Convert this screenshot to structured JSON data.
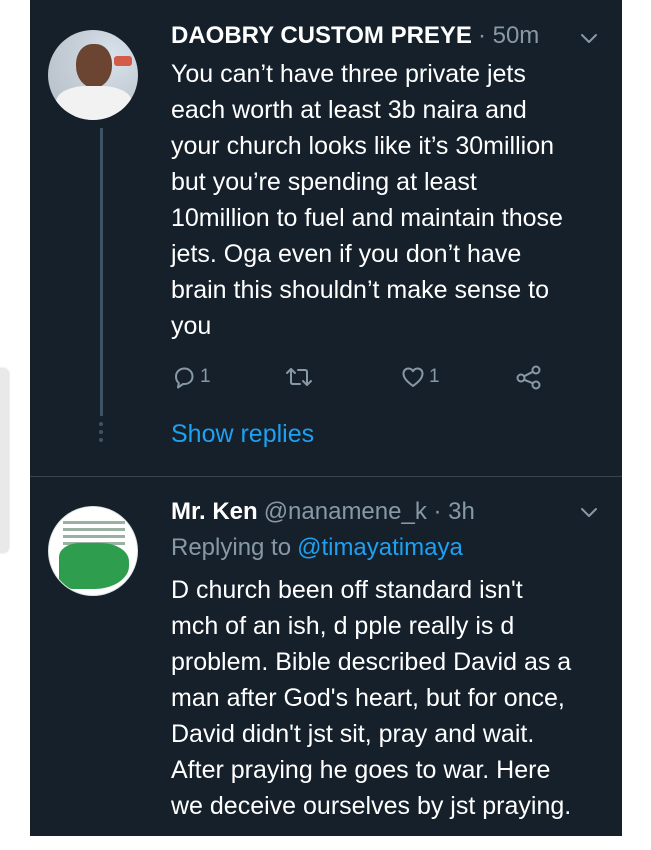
{
  "tweets": [
    {
      "author": "DAOBRY CUSTOM PREYE",
      "meta": "· 50m",
      "text": "You can’t have three private jets\neach worth at least 3b naira and\nyour church looks like it’s 30million\nbut you’re spending at least\n10million to fuel and maintain those\njets. Oga even if you don’t have\nbrain this shouldn’t make sense to\nyou",
      "reply_count": "1",
      "retweet_count": "",
      "like_count": "1",
      "show_replies": "Show replies",
      "avatar_icon": "profile-photo"
    },
    {
      "author": "Mr. Ken",
      "meta": "@nanamene_k · 3h",
      "replying_label": "Replying to",
      "replying_handle": "@timayatimaya",
      "text": "D church been off standard isn't\nmch of an ish, d pple really is d\nproblem. Bible described David as a\nman after God's heart, but for once,\nDavid didn't jst sit, pray and wait.\nAfter praying he goes to war. Here\nwe deceive ourselves by jst praying.",
      "avatar_icon": "green-map-logo"
    }
  ],
  "icons": {
    "reply": "reply-icon",
    "retweet": "retweet-icon",
    "like": "heart-icon",
    "share": "share-icon",
    "more": "chevron-down-icon"
  },
  "colors": {
    "background": "#15202b",
    "text": "#ffffff",
    "secondary": "#8899a6",
    "accent": "#1da1f2",
    "divider": "#38444d"
  }
}
